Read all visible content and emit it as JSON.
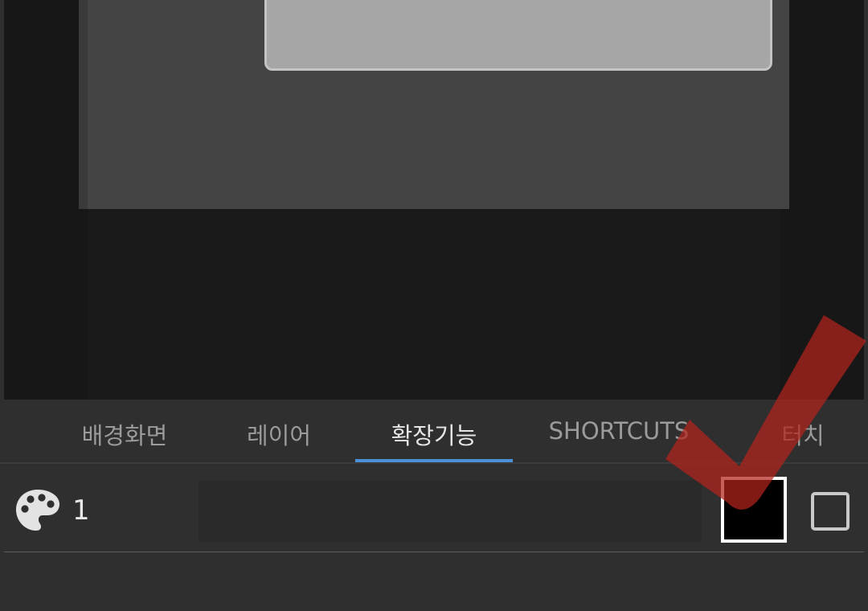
{
  "tabs": [
    {
      "label": "배경화면",
      "active": false
    },
    {
      "label": "레이어",
      "active": false
    },
    {
      "label": "확장기능",
      "active": true
    },
    {
      "label": "SHORTCUTS",
      "active": false
    },
    {
      "label": "터치",
      "active": false
    }
  ],
  "toolbar": {
    "palette_icon": "palette-icon",
    "palette_count": "1",
    "selected_color": "#000000",
    "checkbox_checked": false
  },
  "colors": {
    "accent": "#4a90d9",
    "annotation": "#b3221c"
  }
}
